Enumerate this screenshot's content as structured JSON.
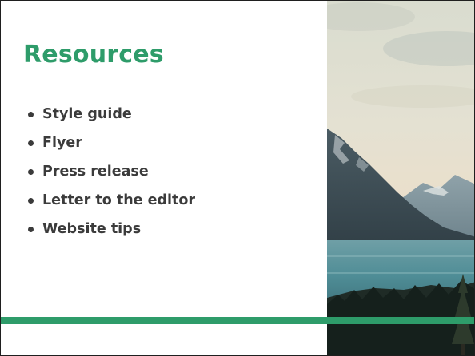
{
  "slide": {
    "title": "Resources",
    "accent_color": "#2e9c6a",
    "bullets": [
      {
        "label": "Style guide"
      },
      {
        "label": "Flyer"
      },
      {
        "label": "Press release"
      },
      {
        "label": "Letter to the editor"
      },
      {
        "label": "Website tips"
      }
    ]
  }
}
